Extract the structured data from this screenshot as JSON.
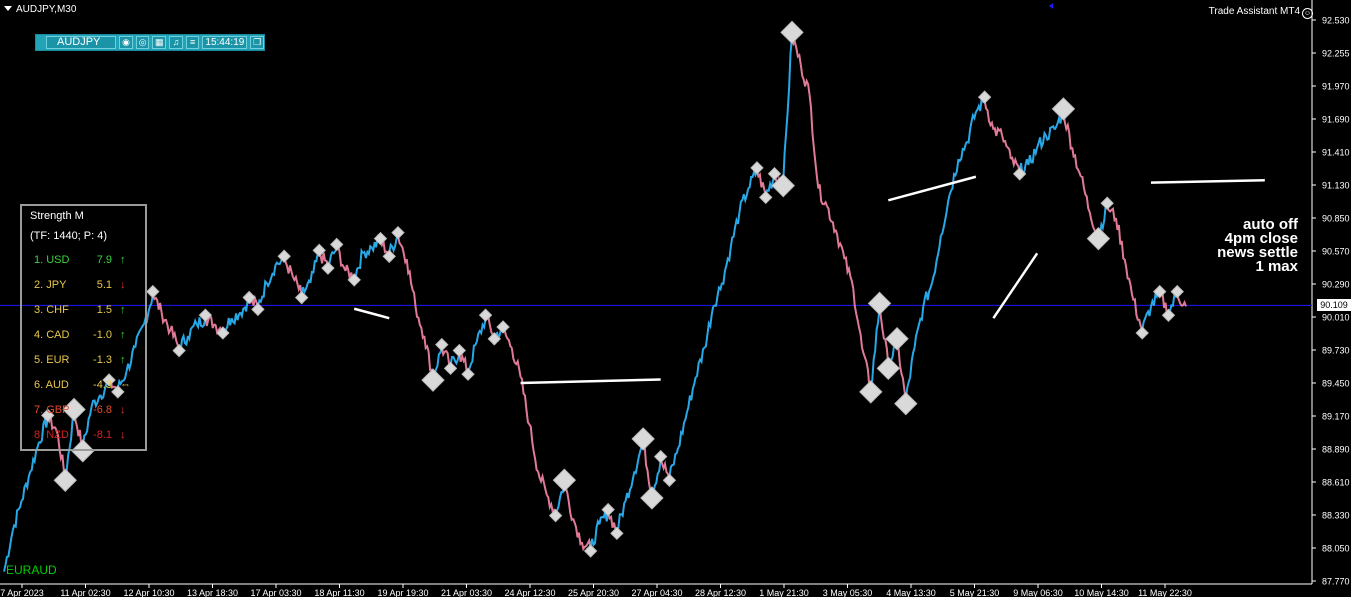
{
  "window": {
    "title": "AUDJPY,M30",
    "indicator_label": "Trade Assistant MT4"
  },
  "toolbar": {
    "symbol": "AUDJPY",
    "buttons": [
      "camera-icon",
      "eye-icon",
      "calendar-icon",
      "bell-icon",
      "menu-icon"
    ],
    "time": "15:44:19",
    "window_button": "restore-icon"
  },
  "strength": {
    "title": "Strength M",
    "params": "(TF: 1440;  P: 4)",
    "rows": [
      {
        "rank": "1.  USD",
        "value": "7.9",
        "dir": "up",
        "color": "#3cd33c"
      },
      {
        "rank": "2.  JPY",
        "value": "5.1",
        "dir": "down",
        "color": "#e8c84a"
      },
      {
        "rank": "3.  CHF",
        "value": "1.5",
        "dir": "up",
        "color": "#e8c84a"
      },
      {
        "rank": "4.  CAD",
        "value": "-1.0",
        "dir": "up",
        "color": "#e8c84a"
      },
      {
        "rank": "5.  EUR",
        "value": "-1.3",
        "dir": "up",
        "color": "#e8c84a"
      },
      {
        "rank": "6.  AUD",
        "value": "-4.3",
        "dir": "side",
        "color": "#e8c84a"
      },
      {
        "rank": "7.  GBP",
        "value": "-6.8",
        "dir": "down",
        "color": "#e84a2a"
      },
      {
        "rank": "8.  NZD",
        "value": "-8.1",
        "dir": "down",
        "color": "#d82020"
      }
    ]
  },
  "note": [
    "auto off",
    "4pm close",
    "news settle",
    "1 max"
  ],
  "sub_symbol": "EURAUD",
  "current_price": "90.109",
  "chart_data": {
    "type": "line",
    "y_ticks": [
      "92.530",
      "92.255",
      "91.970",
      "91.690",
      "91.410",
      "91.130",
      "90.850",
      "90.570",
      "90.290",
      "90.010",
      "89.730",
      "89.450",
      "89.170",
      "88.890",
      "88.610",
      "88.330",
      "88.050",
      "87.770"
    ],
    "x_ticks": [
      "7 Apr 2023",
      "11 Apr 02:30",
      "12 Apr 10:30",
      "13 Apr 18:30",
      "17 Apr 03:30",
      "18 Apr 11:30",
      "19 Apr 19:30",
      "21 Apr 03:30",
      "24 Apr 12:30",
      "25 Apr 20:30",
      "27 Apr 04:30",
      "28 Apr 12:30",
      "1 May 21:30",
      "3 May 05:30",
      "4 May 13:30",
      "5 May 21:30",
      "9 May 06:30",
      "10 May 14:30",
      "11 May 22:30"
    ],
    "ylim": [
      87.77,
      92.53
    ],
    "current_price": 90.109,
    "price_path": [
      [
        0,
        87.85
      ],
      [
        1,
        88.2
      ],
      [
        2,
        88.45
      ],
      [
        3,
        88.7
      ],
      [
        4,
        88.95
      ],
      [
        5,
        89.15
      ],
      [
        6,
        89.05
      ],
      [
        7,
        88.65
      ],
      [
        8,
        89.2
      ],
      [
        9,
        88.9
      ],
      [
        10,
        89.25
      ],
      [
        11,
        89.35
      ],
      [
        12,
        89.45
      ],
      [
        13,
        89.4
      ],
      [
        14,
        89.55
      ],
      [
        15,
        89.75
      ],
      [
        16,
        89.95
      ],
      [
        17,
        90.2
      ],
      [
        18,
        90.05
      ],
      [
        19,
        89.9
      ],
      [
        20,
        89.75
      ],
      [
        21,
        89.85
      ],
      [
        22,
        89.95
      ],
      [
        23,
        90.0
      ],
      [
        24,
        89.95
      ],
      [
        25,
        89.9
      ],
      [
        26,
        90.0
      ],
      [
        27,
        90.05
      ],
      [
        28,
        90.15
      ],
      [
        29,
        90.1
      ],
      [
        30,
        90.3
      ],
      [
        31,
        90.45
      ],
      [
        32,
        90.5
      ],
      [
        33,
        90.35
      ],
      [
        34,
        90.2
      ],
      [
        35,
        90.3
      ],
      [
        36,
        90.55
      ],
      [
        37,
        90.45
      ],
      [
        38,
        90.6
      ],
      [
        39,
        90.4
      ],
      [
        40,
        90.35
      ],
      [
        41,
        90.55
      ],
      [
        42,
        90.6
      ],
      [
        43,
        90.65
      ],
      [
        44,
        90.55
      ],
      [
        45,
        90.7
      ],
      [
        46,
        90.5
      ],
      [
        47,
        90.1
      ],
      [
        48,
        89.85
      ],
      [
        49,
        89.5
      ],
      [
        50,
        89.75
      ],
      [
        51,
        89.6
      ],
      [
        52,
        89.7
      ],
      [
        53,
        89.55
      ],
      [
        54,
        89.8
      ],
      [
        55,
        90.0
      ],
      [
        56,
        89.85
      ],
      [
        57,
        89.9
      ],
      [
        58,
        89.75
      ],
      [
        59,
        89.5
      ],
      [
        60,
        89.1
      ],
      [
        61,
        88.7
      ],
      [
        62,
        88.5
      ],
      [
        63,
        88.35
      ],
      [
        64,
        88.6
      ],
      [
        65,
        88.3
      ],
      [
        66,
        88.1
      ],
      [
        67,
        88.05
      ],
      [
        68,
        88.25
      ],
      [
        69,
        88.35
      ],
      [
        70,
        88.2
      ],
      [
        71,
        88.45
      ],
      [
        72,
        88.7
      ],
      [
        73,
        88.95
      ],
      [
        74,
        88.5
      ],
      [
        75,
        88.8
      ],
      [
        76,
        88.65
      ],
      [
        77,
        88.9
      ],
      [
        78,
        89.2
      ],
      [
        79,
        89.5
      ],
      [
        80,
        89.75
      ],
      [
        81,
        90.1
      ],
      [
        82,
        90.3
      ],
      [
        83,
        90.6
      ],
      [
        84,
        90.9
      ],
      [
        85,
        91.1
      ],
      [
        86,
        91.25
      ],
      [
        87,
        91.05
      ],
      [
        88,
        91.2
      ],
      [
        89,
        91.15
      ],
      [
        90,
        92.4
      ],
      [
        91,
        92.15
      ],
      [
        92,
        91.9
      ],
      [
        93,
        91.1
      ],
      [
        94,
        90.95
      ],
      [
        95,
        90.75
      ],
      [
        96,
        90.5
      ],
      [
        97,
        90.25
      ],
      [
        98,
        89.75
      ],
      [
        99,
        89.4
      ],
      [
        100,
        90.1
      ],
      [
        101,
        89.6
      ],
      [
        102,
        89.8
      ],
      [
        103,
        89.3
      ],
      [
        104,
        89.75
      ],
      [
        105,
        90.1
      ],
      [
        106,
        90.3
      ],
      [
        107,
        90.7
      ],
      [
        108,
        91.05
      ],
      [
        109,
        91.35
      ],
      [
        110,
        91.5
      ],
      [
        111,
        91.75
      ],
      [
        112,
        91.85
      ],
      [
        113,
        91.6
      ],
      [
        114,
        91.55
      ],
      [
        115,
        91.35
      ],
      [
        116,
        91.25
      ],
      [
        117,
        91.3
      ],
      [
        118,
        91.45
      ],
      [
        119,
        91.55
      ],
      [
        120,
        91.6
      ],
      [
        121,
        91.75
      ],
      [
        122,
        91.45
      ],
      [
        123,
        91.2
      ],
      [
        124,
        90.9
      ],
      [
        125,
        90.7
      ],
      [
        126,
        90.95
      ],
      [
        127,
        90.85
      ],
      [
        128,
        90.5
      ],
      [
        129,
        90.15
      ],
      [
        130,
        89.9
      ],
      [
        131,
        90.1
      ],
      [
        132,
        90.2
      ],
      [
        133,
        90.05
      ],
      [
        134,
        90.2
      ],
      [
        135,
        90.1
      ]
    ]
  }
}
